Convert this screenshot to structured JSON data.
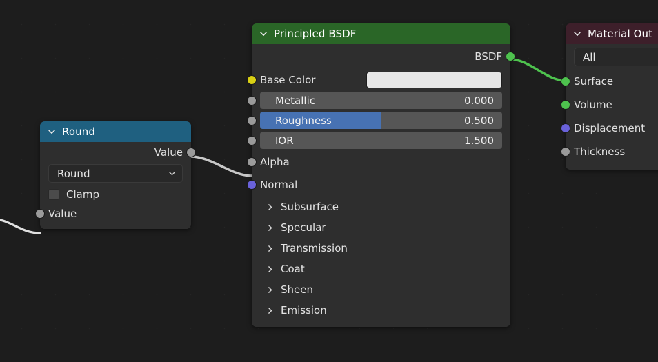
{
  "editor": {
    "name": "shader-node-editor",
    "background_color": "#1d1d1d"
  },
  "nodes": {
    "math_round": {
      "title": "Round",
      "header_color": "#1f6080",
      "outputs": [
        {
          "label": "Value",
          "socket": "gray"
        }
      ],
      "operation_dropdown": {
        "value": "Round"
      },
      "clamp": {
        "label": "Clamp",
        "checked": false
      },
      "inputs": [
        {
          "label": "Value",
          "socket": "gray"
        }
      ]
    },
    "principled_bsdf": {
      "title": "Principled BSDF",
      "header_color": "#2a6627",
      "outputs": [
        {
          "label": "BSDF",
          "socket": "green"
        }
      ],
      "base_color": {
        "label": "Base Color",
        "socket": "yellow",
        "swatch_color": "#e6e6e6"
      },
      "sliders": [
        {
          "label": "Metallic",
          "value": "0.000",
          "fill_percent": 0,
          "socket": "gray"
        },
        {
          "label": "Roughness",
          "value": "0.500",
          "fill_percent": 50,
          "socket": "gray"
        },
        {
          "label": "IOR",
          "value": "1.500",
          "fill_percent": 0,
          "socket": "gray"
        }
      ],
      "plain_inputs": [
        {
          "label": "Alpha",
          "socket": "gray"
        },
        {
          "label": "Normal",
          "socket": "purple"
        }
      ],
      "panels": [
        {
          "label": "Subsurface"
        },
        {
          "label": "Specular"
        },
        {
          "label": "Transmission"
        },
        {
          "label": "Coat"
        },
        {
          "label": "Sheen"
        },
        {
          "label": "Emission"
        }
      ]
    },
    "material_output": {
      "title": "Material Out",
      "header_color": "#3d1f2a",
      "target_dropdown": {
        "value": "All"
      },
      "inputs": [
        {
          "label": "Surface",
          "socket": "green"
        },
        {
          "label": "Volume",
          "socket": "green"
        },
        {
          "label": "Displacement",
          "socket": "purple"
        },
        {
          "label": "Thickness",
          "socket": "gray"
        }
      ]
    }
  },
  "links": [
    {
      "name": "bsdf-to-surface",
      "color": "#4ec24e"
    },
    {
      "name": "round-value-to-alpha",
      "color": "#c8c8c8"
    },
    {
      "name": "offscreen-to-round-value",
      "color": "#e0e0e0"
    }
  ]
}
